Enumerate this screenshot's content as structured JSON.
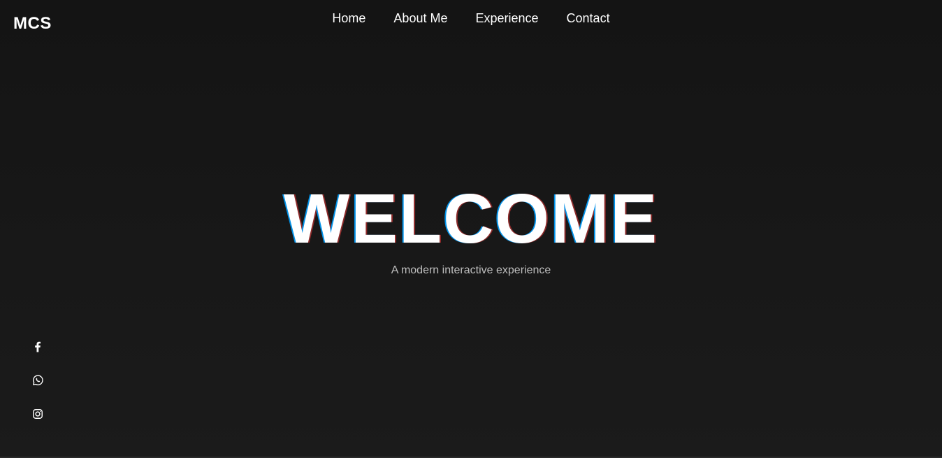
{
  "header": {
    "logo": "MCS"
  },
  "nav": {
    "items": [
      {
        "label": "Home"
      },
      {
        "label": "About Me"
      },
      {
        "label": "Experience"
      },
      {
        "label": "Contact"
      }
    ]
  },
  "hero": {
    "title": "WELCOME",
    "subtitle": "A modern interactive experience"
  },
  "social": {
    "icons": [
      "facebook-icon",
      "whatsapp-icon",
      "instagram-icon"
    ]
  },
  "colors": {
    "background": "#161616",
    "text": "#ffffff",
    "subtitle": "#bdbdbd"
  }
}
